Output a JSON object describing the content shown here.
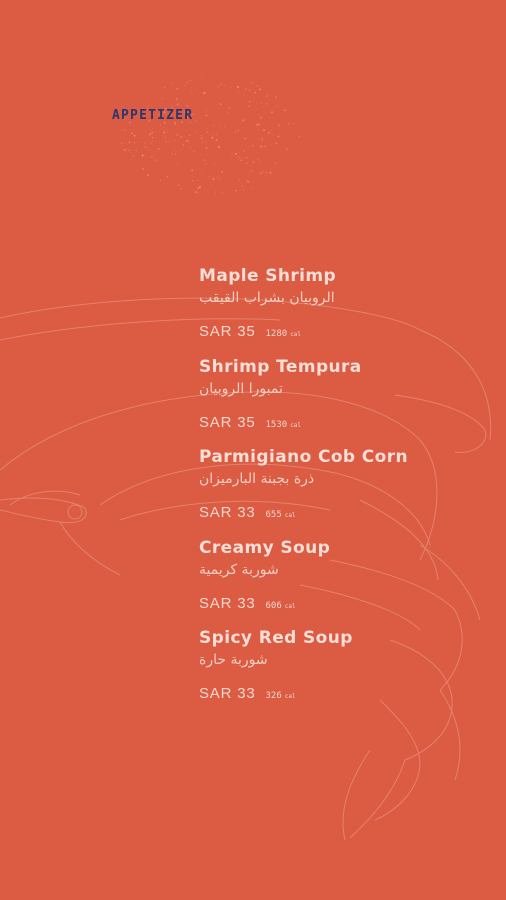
{
  "menu": {
    "category": "APPETIZER",
    "calorie_unit": "cal",
    "items": [
      {
        "name": "Maple Shrimp",
        "name_ar": "الروبيان بشراب القيقب",
        "price": "SAR 35",
        "calories": "1280"
      },
      {
        "name": "Shrimp Tempura",
        "name_ar": "تمبورا الروبيان",
        "price": "SAR 35",
        "calories": "1530"
      },
      {
        "name": "Parmigiano Cob Corn",
        "name_ar": "ذرة بجبنة البارميزان",
        "price": "SAR 33",
        "calories": "655"
      },
      {
        "name": "Creamy Soup",
        "name_ar": "شوربة كريمية",
        "price": "SAR 33",
        "calories": "606"
      },
      {
        "name": "Spicy Red Soup",
        "name_ar": "شوربة حارة",
        "price": "SAR 33",
        "calories": "326"
      }
    ]
  },
  "colors": {
    "background": "#dc5b43",
    "category_text": "#2d3670",
    "item_text": "#f6ddd5",
    "line_art": "#e88a76"
  },
  "decorations": {
    "background_art": "shrimp-outline-illustration",
    "sparkle": "dot-scatter-pattern"
  }
}
